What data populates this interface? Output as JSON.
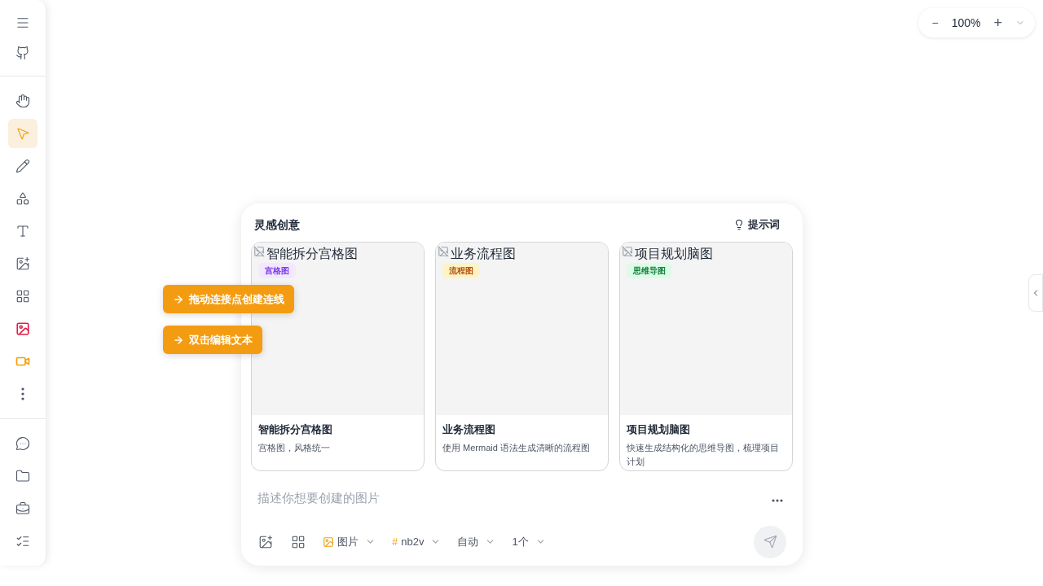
{
  "sidebar": {
    "tools": [
      {
        "selected": false
      },
      {
        "selected": true
      },
      {
        "selected": false
      },
      {
        "selected": false
      },
      {
        "selected": false
      },
      {
        "selected": false
      },
      {
        "selected": false
      },
      {
        "selected": false,
        "color": "#e11d48"
      },
      {
        "selected": false,
        "color": "#f59e0b"
      },
      {
        "selected": false
      }
    ]
  },
  "zoom": {
    "minus": "−",
    "value": "100%",
    "plus": "+"
  },
  "hints": [
    "拖动连接点创建连线",
    "双击编辑文本"
  ],
  "panel": {
    "title": "灵感创意",
    "prompt_button": "提示词",
    "cards": [
      {
        "image_alt": "智能拆分宫格图",
        "tag": "宫格图",
        "color": "#7c3aed",
        "title": "智能拆分宫格图",
        "description": "宫格图，风格统一"
      },
      {
        "image_alt": "业务流程图",
        "tag": "流程图",
        "color": "#b45309",
        "title": "业务流程图",
        "description": "使用 Mermaid 语法生成清晰的流程图"
      },
      {
        "image_alt": "项目规划脑图",
        "tag": "思维导图",
        "color": "#15803d",
        "title": "项目规划脑图",
        "description": "快速生成结构化的思维导图，梳理项目计划"
      }
    ],
    "input": {
      "placeholder": "描述你想要创建的图片"
    },
    "options": [
      {
        "kind": "type",
        "label": "图片"
      },
      {
        "kind": "model",
        "label": "nb2v",
        "prefix": "#"
      },
      {
        "kind": "plain",
        "label": "自动"
      },
      {
        "kind": "plain",
        "label": "1个"
      }
    ]
  }
}
